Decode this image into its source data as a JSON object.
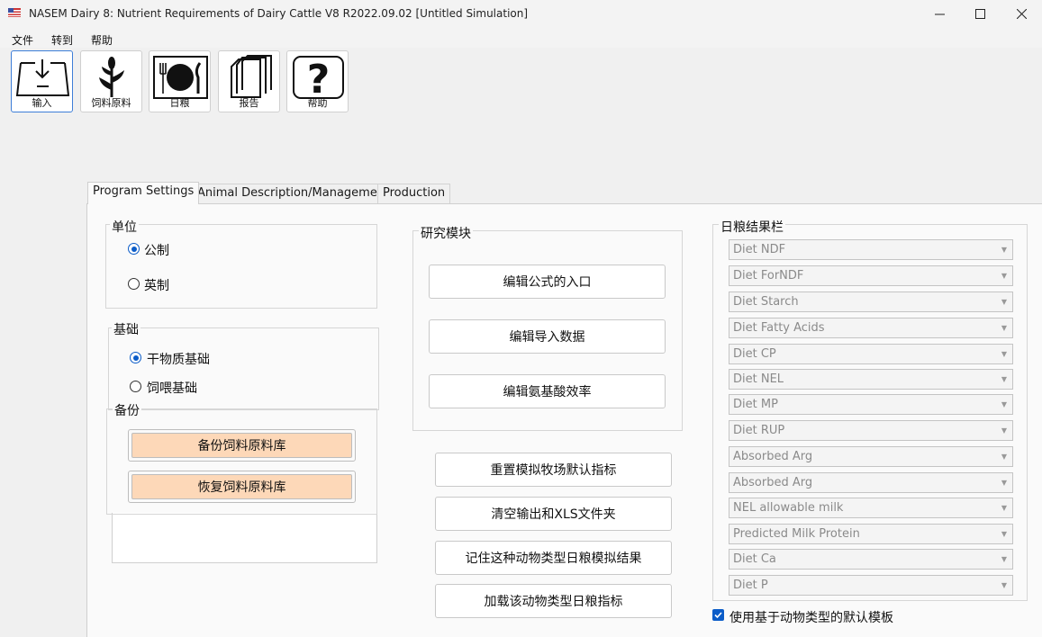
{
  "window": {
    "title": "NASEM Dairy 8: Nutrient Requirements of Dairy Cattle  V8 R2022.09.02 [Untitled Simulation]"
  },
  "menu": [
    "文件",
    "转到",
    "帮助"
  ],
  "toolbar": [
    {
      "label": "输入",
      "icon": "input-icon"
    },
    {
      "label": "饲料原料",
      "icon": "corn-plant-icon"
    },
    {
      "label": "日粮",
      "icon": "plate-utensils-icon"
    },
    {
      "label": "报告",
      "icon": "report-pages-icon"
    },
    {
      "label": "帮助",
      "icon": "question-mark-icon"
    }
  ],
  "tabs": [
    "Program Settings",
    "Animal Description/Management",
    "Production"
  ],
  "units": {
    "title": "单位",
    "options": [
      "公制",
      "英制"
    ],
    "selected": "公制"
  },
  "basis": {
    "title": "基础",
    "options": [
      "干物质基础",
      "饲喂基础"
    ],
    "selected": "干物质基础"
  },
  "backup": {
    "title": "备份",
    "buttons": [
      "备份饲料原料库",
      "恢复饲料原料库"
    ]
  },
  "research": {
    "title": "研究模块",
    "buttons": [
      "编辑公式的入口",
      "编辑导入数据",
      "编辑氨基酸效率"
    ]
  },
  "actions": [
    "重置模拟牧场默认指标",
    "清空输出和XLS文件夹",
    "记住这种动物类型日粮模拟结果",
    "加载该动物类型日粮指标"
  ],
  "diet_results": {
    "title": "日粮结果栏",
    "selects": [
      "Diet NDF",
      "Diet ForNDF",
      "Diet Starch",
      "Diet Fatty Acids",
      "Diet CP",
      "Diet NEL",
      "Diet MP",
      "Diet RUP",
      "Absorbed Arg",
      "Absorbed Arg",
      "NEL allowable milk",
      "Predicted Milk Protein",
      "Diet Ca",
      "Diet P"
    ]
  },
  "default_template": {
    "label": "使用基于动物类型的默认模板",
    "checked": true
  },
  "colors": {
    "accent": "#0b5cc8",
    "peach_button": "#fdd8b8"
  }
}
